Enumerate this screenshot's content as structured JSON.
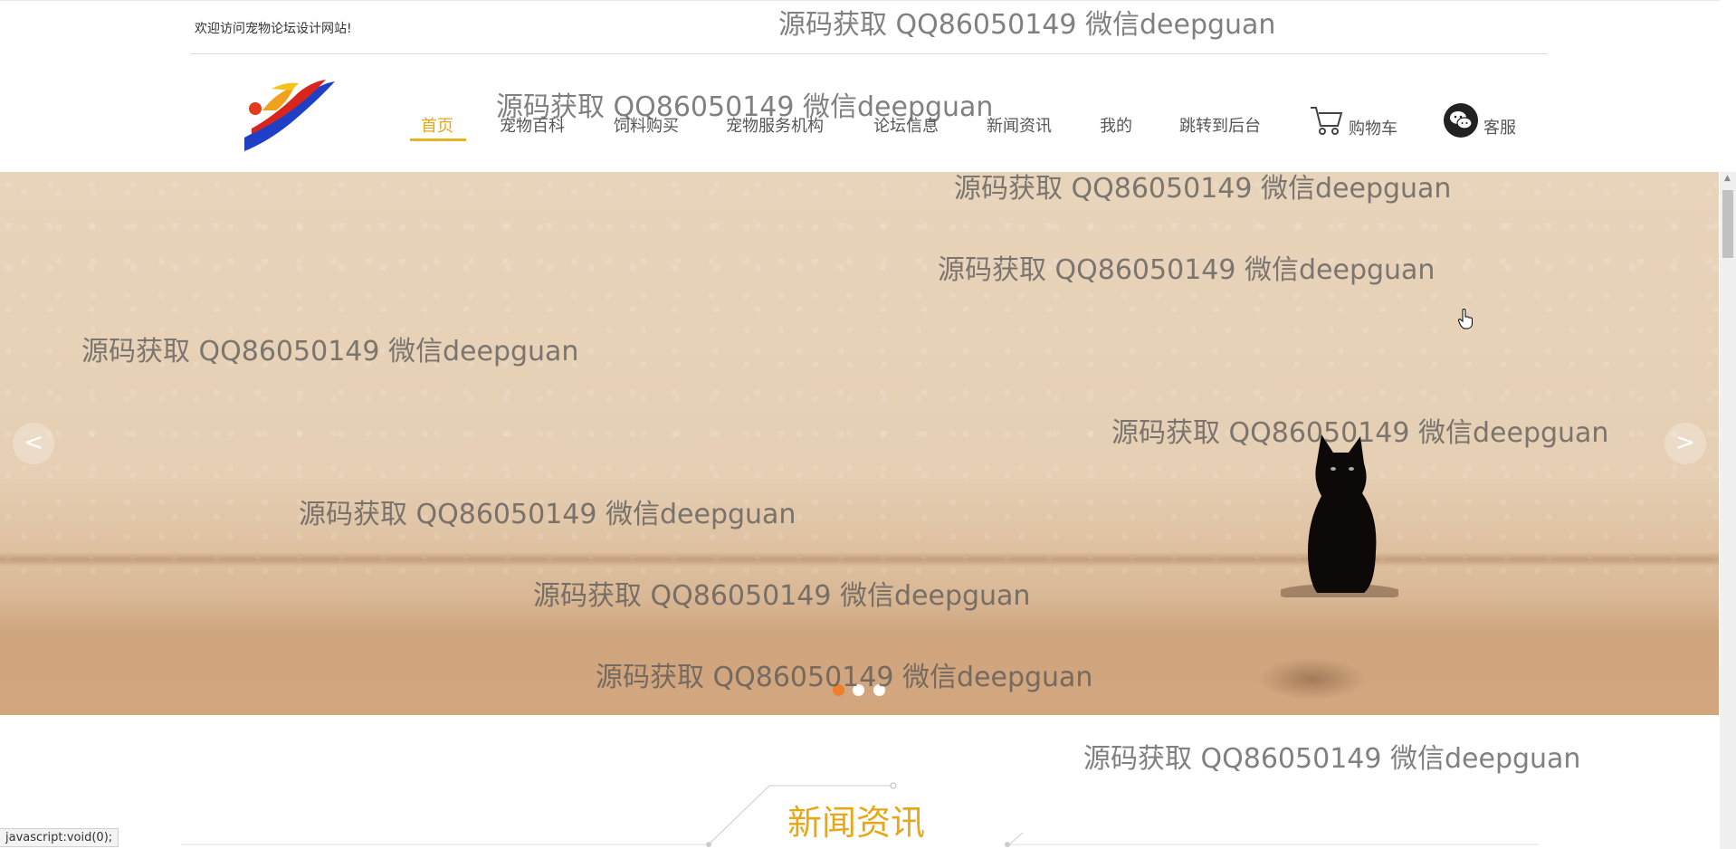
{
  "topbar": {
    "welcome": "欢迎访问宠物论坛设计网站!"
  },
  "nav": {
    "items": [
      {
        "label": "首页",
        "active": true
      },
      {
        "label": "宠物百科"
      },
      {
        "label": "饲料购买"
      },
      {
        "label": "宠物服务机构"
      },
      {
        "label": "论坛信息"
      },
      {
        "label": "新闻资讯"
      },
      {
        "label": "我的"
      },
      {
        "label": "跳转到后台"
      }
    ],
    "cart_label": "购物车",
    "service_label": "客服"
  },
  "banner": {
    "prev_label": "<",
    "next_label": ">",
    "slide_count": 3,
    "active_slide": 0
  },
  "section": {
    "title": "新闻资讯"
  },
  "statusbar": {
    "text": "javascript:void(0);"
  },
  "watermark": {
    "text": "源码获取 QQ86050149 微信deepguan"
  },
  "colors": {
    "accent": "#e6a817",
    "dot_active": "#ef7f2b"
  }
}
